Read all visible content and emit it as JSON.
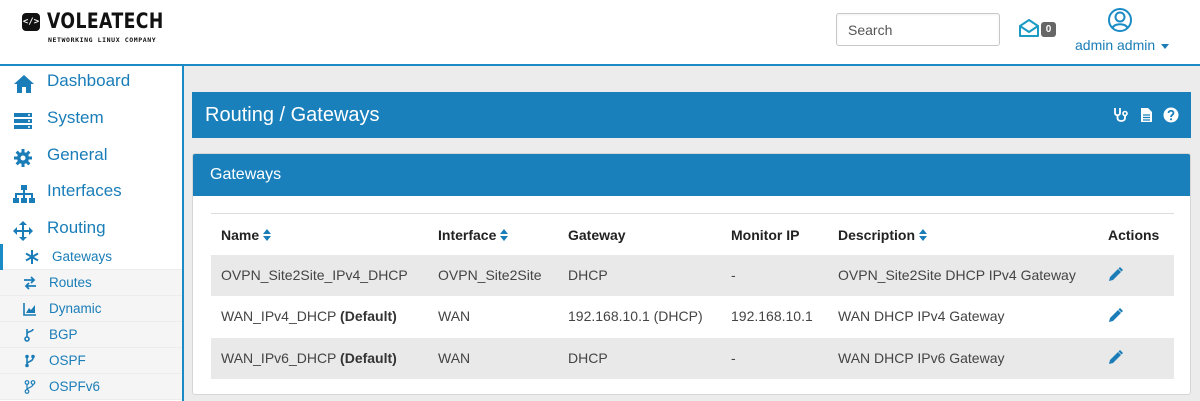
{
  "header": {
    "logo_title": "VOLEATECH",
    "logo_subtitle": "NETWORKING LINUX COMPANY",
    "logo_icon_text": "</>",
    "search_placeholder": "Search",
    "notification_count": "0",
    "user_label": "admin admin"
  },
  "sidebar": {
    "items": [
      {
        "label": "Dashboard",
        "icon": "home-icon"
      },
      {
        "label": "System",
        "icon": "server-icon"
      },
      {
        "label": "General",
        "icon": "gear-icon"
      },
      {
        "label": "Interfaces",
        "icon": "sitemap-icon"
      },
      {
        "label": "Routing",
        "icon": "arrows-move-icon"
      }
    ],
    "subitems": [
      {
        "label": "Gateways",
        "icon": "asterisk-icon",
        "active": true
      },
      {
        "label": "Routes",
        "icon": "exchange-icon"
      },
      {
        "label": "Dynamic",
        "icon": "area-chart-icon"
      },
      {
        "label": "BGP",
        "icon": "bgp-branch-icon"
      },
      {
        "label": "OSPF",
        "icon": "code-fork-icon"
      },
      {
        "label": "OSPFv6",
        "icon": "code-fork-outline-icon"
      }
    ]
  },
  "page": {
    "title": "Routing / Gateways",
    "title_icons": [
      "stethoscope-icon",
      "document-icon",
      "help-icon"
    ]
  },
  "panel": {
    "title": "Gateways",
    "columns": [
      "Name",
      "Interface",
      "Gateway",
      "Monitor IP",
      "Description",
      "Actions"
    ],
    "rows": [
      {
        "name": "OVPN_Site2Site_IPv4_DHCP",
        "default_tag": "",
        "interface": "OVPN_Site2Site",
        "gateway": "DHCP",
        "monitor_ip": "-",
        "description": "OVPN_Site2Site DHCP IPv4 Gateway"
      },
      {
        "name": "WAN_IPv4_DHCP ",
        "default_tag": "(Default)",
        "interface": "WAN",
        "gateway": "192.168.10.1 (DHCP)",
        "monitor_ip": "192.168.10.1",
        "description": "WAN DHCP IPv4 Gateway"
      },
      {
        "name": "WAN_IPv6_DHCP ",
        "default_tag": "(Default)",
        "interface": "WAN",
        "gateway": "DHCP",
        "monitor_ip": "-",
        "description": "WAN DHCP IPv6 Gateway"
      }
    ]
  },
  "colors": {
    "accent": "#1a80bb",
    "link": "#1a7db8",
    "row_alt": "#e9e9e9"
  }
}
